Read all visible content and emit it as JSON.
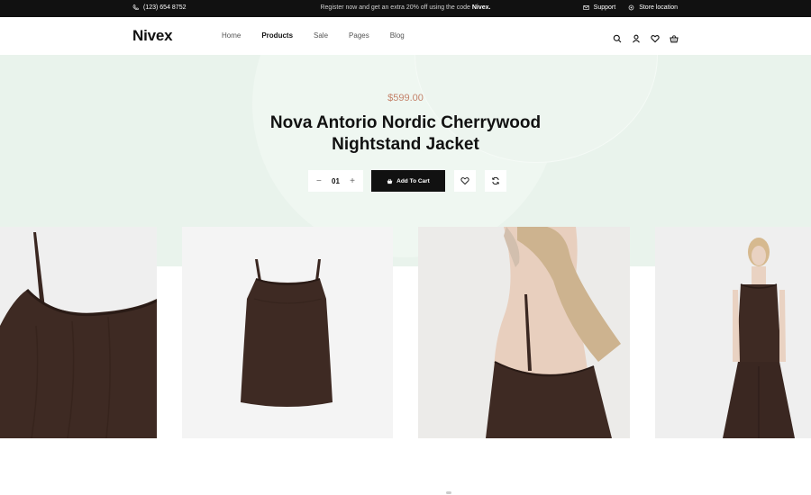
{
  "topbar": {
    "phone": "(123) 654 8752",
    "promo_text": "Register now and get an extra 20% off using the code",
    "promo_code": "Nivex.",
    "support": "Support",
    "store_location": "Store location"
  },
  "header": {
    "logo": "Nivex",
    "nav": [
      "Home",
      "Products",
      "Sale",
      "Pages",
      "Blog"
    ],
    "active_nav": "Products",
    "icons": [
      "search-icon",
      "user-icon",
      "heart-icon",
      "cart-icon"
    ]
  },
  "product": {
    "price": "$599.00",
    "title_line1": "Nova Antorio Nordic Cherrywood",
    "title_line2": "Nightstand Jacket",
    "quantity": "01",
    "minus": "−",
    "plus": "+",
    "add_to_cart": "Add To Cart"
  },
  "colors": {
    "hero_bg": "#e9f3ec",
    "price": "#c4826a",
    "dark": "#111111",
    "garment": "#3e2a23"
  },
  "gallery": [
    {
      "name": "gallery-image-strap-closeup"
    },
    {
      "name": "gallery-image-top-flat"
    },
    {
      "name": "gallery-image-model-back"
    },
    {
      "name": "gallery-image-model-full"
    }
  ]
}
